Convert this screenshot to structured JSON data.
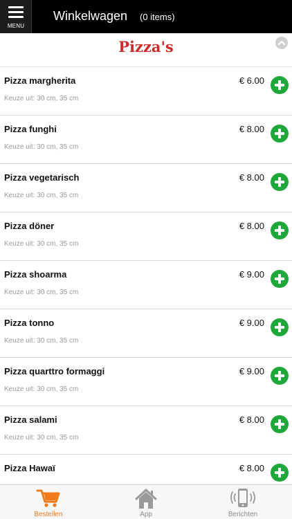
{
  "header": {
    "menu_label": "MENU",
    "title": "Winkelwagen",
    "cart_count": "(0 items)"
  },
  "section": {
    "heading": "Pizza's"
  },
  "items": [
    {
      "name": "Pizza margherita",
      "price": "€ 6.00",
      "desc": "Keuze uit: 30 cm, 35 cm"
    },
    {
      "name": "Pizza funghi",
      "price": "€ 8.00",
      "desc": "Keuze uit: 30 cm, 35 cm"
    },
    {
      "name": "Pizza vegetarisch",
      "price": "€ 8.00",
      "desc": "Keuze uit: 30 cm, 35 cm"
    },
    {
      "name": "Pizza döner",
      "price": "€ 8.00",
      "desc": "Keuze uit: 30 cm, 35 cm"
    },
    {
      "name": "Pizza shoarma",
      "price": "€ 9.00",
      "desc": "Keuze uit: 30 cm, 35 cm"
    },
    {
      "name": "Pizza tonno",
      "price": "€ 9.00",
      "desc": "Keuze uit: 30 cm, 35 cm"
    },
    {
      "name": "Pizza quarttro formaggi",
      "price": "€ 9.00",
      "desc": "Keuze uit: 30 cm, 35 cm"
    },
    {
      "name": "Pizza salami",
      "price": "€ 8.00",
      "desc": "Keuze uit: 30 cm, 35 cm"
    },
    {
      "name": "Pizza Hawaï",
      "price": "€ 8.00",
      "desc": ""
    }
  ],
  "tabbar": {
    "tabs": [
      {
        "label": "Bestellen",
        "icon": "cart-icon",
        "active": true
      },
      {
        "label": "App",
        "icon": "home-icon",
        "active": false
      },
      {
        "label": "Berichten",
        "icon": "phone-icon",
        "active": false
      }
    ]
  },
  "colors": {
    "accent": "#f07a1a",
    "heading_red": "#cc2b2b",
    "add_green": "#1fa83a",
    "topbar": "#000000"
  }
}
